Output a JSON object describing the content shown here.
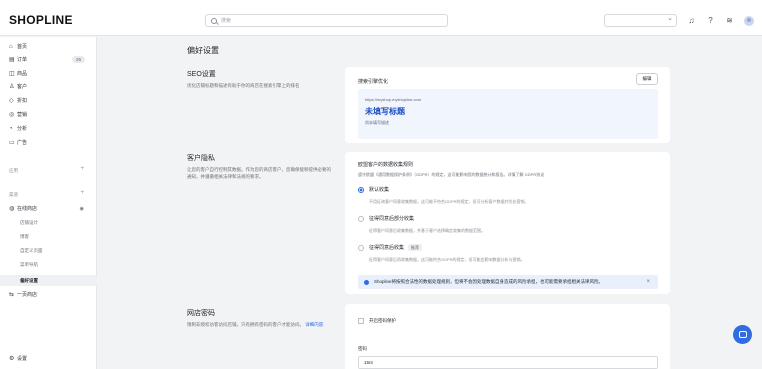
{
  "app": {
    "logo": "SHOPLINE"
  },
  "topbar": {
    "search_placeholder": "搜索",
    "icons": [
      "bell-icon",
      "help-icon",
      "wifi-icon",
      "avatar"
    ]
  },
  "sidebar": {
    "items": [
      {
        "label": "首页",
        "icon": "⌂"
      },
      {
        "label": "订单",
        "icon": "▤",
        "badge": "26"
      },
      {
        "label": "商品",
        "icon": "◫"
      },
      {
        "label": "客户",
        "icon": "♙"
      },
      {
        "label": "折扣",
        "icon": "◇"
      },
      {
        "label": "营销",
        "icon": "◎"
      },
      {
        "label": "分析",
        "icon": "◔"
      },
      {
        "label": "广告",
        "icon": "▭"
      }
    ],
    "apps_label": "应用",
    "channels_label": "渠道",
    "channel": {
      "label": "在线商店",
      "icon": "◍"
    },
    "sub_items": [
      "店铺设计",
      "博客",
      "自定义页面",
      "菜单导航",
      "偏好设置"
    ],
    "pos": {
      "label": "一页商店",
      "icon": "⇆"
    },
    "settings": {
      "label": "设置",
      "icon": "⚙"
    }
  },
  "main": {
    "title": "偏好设置",
    "seo": {
      "title": "SEO设置",
      "desc": "优化店铺标题和描述有助于你的商店在搜索引擎上的排名",
      "card_head": "搜索引擎优化",
      "edit": "编辑",
      "preview_url": "https://myshop.myshopline.com",
      "preview_title": "未填写标题",
      "preview_desc": "尚未填写描述"
    },
    "privacy": {
      "title": "客户隐私",
      "desc": "让您的客户自行控制其数据。作为您的商店客户，您确保能够提供必要的通知，并遵循相关法律和法规的要求。",
      "card_head": "欧盟客户的数据收集规则",
      "card_sub": "遵守欧盟《通用数据保护条例》（GDPR）的规定，这可能影响您的数据统计和报告。详情了解 GDPR协议",
      "options": [
        {
          "label": "默认收集",
          "desc": "不用征询客户同意收集数据，这可能不符合GDPR的规定，但可分析客户数据并优化营销。",
          "checked": true
        },
        {
          "label": "征得同意后部分收集",
          "desc": "征得客户同意后收集数据，并基于客户选择确定收集的数据范围。",
          "checked": false
        },
        {
          "label": "征得同意后收集",
          "tag": "推荐",
          "desc": "征得客户同意后再收集数据，这可能符合GDPR的规定，但可能会影响数据分析与营销。",
          "checked": false
        }
      ],
      "notice": "Shopline将按照合法性的数据处理规则，但将不会因处理数据自身造成的风险承担，也可能需要承担相关法律风险。"
    },
    "password": {
      "title": "网店密码",
      "desc": "限制非授权访客访问店铺，只有拥有密码的客户才能访问。",
      "link": "详细内容",
      "checkbox": "开启密码保护",
      "field_label": "密码",
      "field_value": "15nt"
    }
  }
}
